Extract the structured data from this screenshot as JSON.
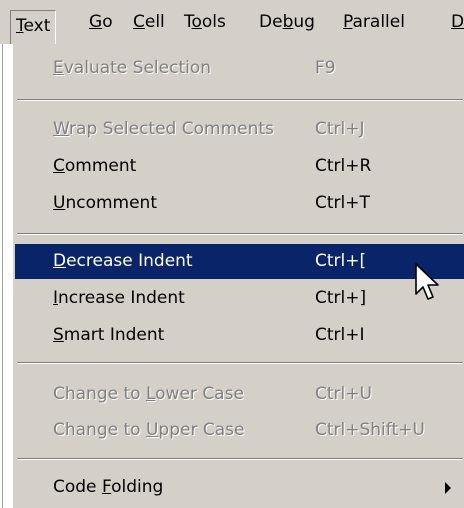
{
  "menubar": {
    "items": [
      {
        "label": "Text",
        "mnemonic": 0,
        "active": true
      },
      {
        "label": "Go",
        "mnemonic": 0
      },
      {
        "label": "Cell",
        "mnemonic": 0
      },
      {
        "label": "Tools",
        "mnemonic": 1
      },
      {
        "label": "Debug",
        "mnemonic": 2
      },
      {
        "label": "Parallel",
        "mnemonic": 0
      },
      {
        "label": "D",
        "mnemonic": 0
      }
    ]
  },
  "text_menu": {
    "items": [
      {
        "label": "Evaluate Selection",
        "mnemonic": 0,
        "shortcut": "F9",
        "enabled": false
      },
      {
        "label": "Wrap Selected Comments",
        "mnemonic": 0,
        "shortcut": "Ctrl+J",
        "enabled": false
      },
      {
        "label": "Comment",
        "mnemonic": 0,
        "shortcut": "Ctrl+R",
        "enabled": true
      },
      {
        "label": "Uncomment",
        "mnemonic": 0,
        "shortcut": "Ctrl+T",
        "enabled": true
      },
      {
        "label": "Decrease Indent",
        "mnemonic": 0,
        "shortcut": "Ctrl+[",
        "enabled": true,
        "highlighted": true
      },
      {
        "label": "Increase Indent",
        "mnemonic": 0,
        "shortcut": "Ctrl+]",
        "enabled": true
      },
      {
        "label": "Smart Indent",
        "mnemonic": 0,
        "shortcut": "Ctrl+I",
        "enabled": true
      },
      {
        "label": "Change to Lower Case",
        "mnemonic": 10,
        "shortcut": "Ctrl+U",
        "enabled": false
      },
      {
        "label": "Change to Upper Case",
        "mnemonic": 10,
        "shortcut": "Ctrl+Shift+U",
        "enabled": false
      },
      {
        "label": "Code Folding",
        "mnemonic": 5,
        "shortcut": "",
        "enabled": true,
        "submenu": true
      }
    ]
  },
  "icons": {
    "submenu_arrow": "triangle-right-icon",
    "cursor": "mouse-pointer-icon"
  },
  "colors": {
    "menu_background": "#d4d0c8",
    "highlight": "#0a246a",
    "highlight_text": "#ffffff",
    "disabled_text": "#808080"
  }
}
